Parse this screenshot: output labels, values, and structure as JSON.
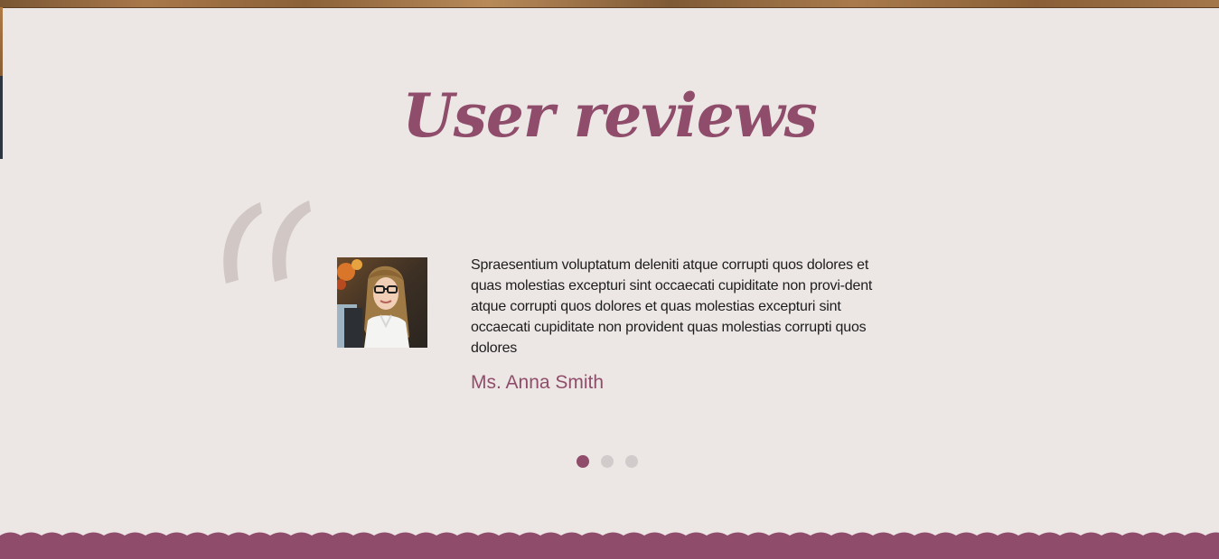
{
  "reviews": {
    "title": "User reviews",
    "quote_icon": "quote-open-icon",
    "items": [
      {
        "text": "Spraesentium voluptatum deleniti atque corrupti quos dolores et quas molestias excepturi sint occaecati cupiditate non provi-dent atque corrupti quos dolores et quas molestias excepturi sint occaecati cupiditate non provident quas molestias corrupti quos dolores",
        "author": "Ms. Anna Smith"
      }
    ],
    "active_index": 0,
    "page_count": 3
  },
  "colors": {
    "accent": "#8f4d6b",
    "background": "#ece7e4",
    "quote": "#d1c8c5",
    "dot_inactive": "#d2cbcb"
  }
}
